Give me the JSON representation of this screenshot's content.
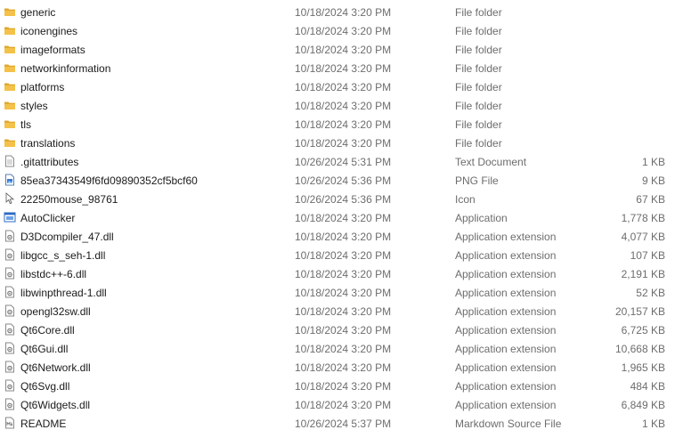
{
  "files": [
    {
      "name": "generic",
      "modified": "10/18/2024 3:20 PM",
      "type": "File folder",
      "size": "",
      "icon": "folder-icon"
    },
    {
      "name": "iconengines",
      "modified": "10/18/2024 3:20 PM",
      "type": "File folder",
      "size": "",
      "icon": "folder-icon"
    },
    {
      "name": "imageformats",
      "modified": "10/18/2024 3:20 PM",
      "type": "File folder",
      "size": "",
      "icon": "folder-icon"
    },
    {
      "name": "networkinformation",
      "modified": "10/18/2024 3:20 PM",
      "type": "File folder",
      "size": "",
      "icon": "folder-icon"
    },
    {
      "name": "platforms",
      "modified": "10/18/2024 3:20 PM",
      "type": "File folder",
      "size": "",
      "icon": "folder-icon"
    },
    {
      "name": "styles",
      "modified": "10/18/2024 3:20 PM",
      "type": "File folder",
      "size": "",
      "icon": "folder-icon"
    },
    {
      "name": "tls",
      "modified": "10/18/2024 3:20 PM",
      "type": "File folder",
      "size": "",
      "icon": "folder-icon"
    },
    {
      "name": "translations",
      "modified": "10/18/2024 3:20 PM",
      "type": "File folder",
      "size": "",
      "icon": "folder-icon"
    },
    {
      "name": ".gitattributes",
      "modified": "10/26/2024 5:31 PM",
      "type": "Text Document",
      "size": "1 KB",
      "icon": "text-document-icon"
    },
    {
      "name": "85ea37343549f6fd09890352cf5bcf60",
      "modified": "10/26/2024 5:36 PM",
      "type": "PNG File",
      "size": "9 KB",
      "icon": "png-image-icon"
    },
    {
      "name": "22250mouse_98761",
      "modified": "10/26/2024 5:36 PM",
      "type": "Icon",
      "size": "67 KB",
      "icon": "mouse-cursor-icon"
    },
    {
      "name": "AutoClicker",
      "modified": "10/18/2024 3:20 PM",
      "type": "Application",
      "size": "1,778 KB",
      "icon": "application-icon"
    },
    {
      "name": "D3Dcompiler_47.dll",
      "modified": "10/18/2024 3:20 PM",
      "type": "Application extension",
      "size": "4,077 KB",
      "icon": "dll-file-icon"
    },
    {
      "name": "libgcc_s_seh-1.dll",
      "modified": "10/18/2024 3:20 PM",
      "type": "Application extension",
      "size": "107 KB",
      "icon": "dll-file-icon"
    },
    {
      "name": "libstdc++-6.dll",
      "modified": "10/18/2024 3:20 PM",
      "type": "Application extension",
      "size": "2,191 KB",
      "icon": "dll-file-icon"
    },
    {
      "name": "libwinpthread-1.dll",
      "modified": "10/18/2024 3:20 PM",
      "type": "Application extension",
      "size": "52 KB",
      "icon": "dll-file-icon"
    },
    {
      "name": "opengl32sw.dll",
      "modified": "10/18/2024 3:20 PM",
      "type": "Application extension",
      "size": "20,157 KB",
      "icon": "dll-file-icon"
    },
    {
      "name": "Qt6Core.dll",
      "modified": "10/18/2024 3:20 PM",
      "type": "Application extension",
      "size": "6,725 KB",
      "icon": "dll-file-icon"
    },
    {
      "name": "Qt6Gui.dll",
      "modified": "10/18/2024 3:20 PM",
      "type": "Application extension",
      "size": "10,668 KB",
      "icon": "dll-file-icon"
    },
    {
      "name": "Qt6Network.dll",
      "modified": "10/18/2024 3:20 PM",
      "type": "Application extension",
      "size": "1,965 KB",
      "icon": "dll-file-icon"
    },
    {
      "name": "Qt6Svg.dll",
      "modified": "10/18/2024 3:20 PM",
      "type": "Application extension",
      "size": "484 KB",
      "icon": "dll-file-icon"
    },
    {
      "name": "Qt6Widgets.dll",
      "modified": "10/18/2024 3:20 PM",
      "type": "Application extension",
      "size": "6,849 KB",
      "icon": "dll-file-icon"
    },
    {
      "name": "README",
      "modified": "10/26/2024 5:37 PM",
      "type": "Markdown Source File",
      "size": "1 KB",
      "icon": "markdown-file-icon"
    }
  ],
  "colors": {
    "folder": "#f4c24a",
    "folder_dark": "#e0a82e",
    "application_blue": "#2d6bc4",
    "text_secondary": "#6d6d6d"
  }
}
